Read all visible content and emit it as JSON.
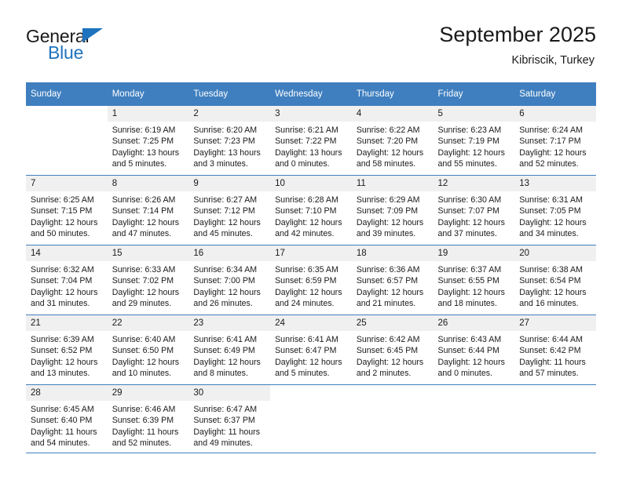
{
  "brand": {
    "name_top": "General",
    "name_bottom": "Blue",
    "triangle_color": "#1e73be"
  },
  "header": {
    "title": "September 2025",
    "subtitle": "Kibriscik, Turkey"
  },
  "theme": {
    "header_blue": "#3f7fbf",
    "daynum_bg": "#f0f0f0",
    "text": "#1a1a1a"
  },
  "weekdays": [
    "Sunday",
    "Monday",
    "Tuesday",
    "Wednesday",
    "Thursday",
    "Friday",
    "Saturday"
  ],
  "labels": {
    "sunrise": "Sunrise:",
    "sunset": "Sunset:",
    "daylight": "Daylight:"
  },
  "weeks": [
    [
      {
        "day": ""
      },
      {
        "day": "1",
        "sunrise": "Sunrise: 6:19 AM",
        "sunset": "Sunset: 7:25 PM",
        "daylight1": "Daylight: 13 hours",
        "daylight2": "and 5 minutes."
      },
      {
        "day": "2",
        "sunrise": "Sunrise: 6:20 AM",
        "sunset": "Sunset: 7:23 PM",
        "daylight1": "Daylight: 13 hours",
        "daylight2": "and 3 minutes."
      },
      {
        "day": "3",
        "sunrise": "Sunrise: 6:21 AM",
        "sunset": "Sunset: 7:22 PM",
        "daylight1": "Daylight: 13 hours",
        "daylight2": "and 0 minutes."
      },
      {
        "day": "4",
        "sunrise": "Sunrise: 6:22 AM",
        "sunset": "Sunset: 7:20 PM",
        "daylight1": "Daylight: 12 hours",
        "daylight2": "and 58 minutes."
      },
      {
        "day": "5",
        "sunrise": "Sunrise: 6:23 AM",
        "sunset": "Sunset: 7:19 PM",
        "daylight1": "Daylight: 12 hours",
        "daylight2": "and 55 minutes."
      },
      {
        "day": "6",
        "sunrise": "Sunrise: 6:24 AM",
        "sunset": "Sunset: 7:17 PM",
        "daylight1": "Daylight: 12 hours",
        "daylight2": "and 52 minutes."
      }
    ],
    [
      {
        "day": "7",
        "sunrise": "Sunrise: 6:25 AM",
        "sunset": "Sunset: 7:15 PM",
        "daylight1": "Daylight: 12 hours",
        "daylight2": "and 50 minutes."
      },
      {
        "day": "8",
        "sunrise": "Sunrise: 6:26 AM",
        "sunset": "Sunset: 7:14 PM",
        "daylight1": "Daylight: 12 hours",
        "daylight2": "and 47 minutes."
      },
      {
        "day": "9",
        "sunrise": "Sunrise: 6:27 AM",
        "sunset": "Sunset: 7:12 PM",
        "daylight1": "Daylight: 12 hours",
        "daylight2": "and 45 minutes."
      },
      {
        "day": "10",
        "sunrise": "Sunrise: 6:28 AM",
        "sunset": "Sunset: 7:10 PM",
        "daylight1": "Daylight: 12 hours",
        "daylight2": "and 42 minutes."
      },
      {
        "day": "11",
        "sunrise": "Sunrise: 6:29 AM",
        "sunset": "Sunset: 7:09 PM",
        "daylight1": "Daylight: 12 hours",
        "daylight2": "and 39 minutes."
      },
      {
        "day": "12",
        "sunrise": "Sunrise: 6:30 AM",
        "sunset": "Sunset: 7:07 PM",
        "daylight1": "Daylight: 12 hours",
        "daylight2": "and 37 minutes."
      },
      {
        "day": "13",
        "sunrise": "Sunrise: 6:31 AM",
        "sunset": "Sunset: 7:05 PM",
        "daylight1": "Daylight: 12 hours",
        "daylight2": "and 34 minutes."
      }
    ],
    [
      {
        "day": "14",
        "sunrise": "Sunrise: 6:32 AM",
        "sunset": "Sunset: 7:04 PM",
        "daylight1": "Daylight: 12 hours",
        "daylight2": "and 31 minutes."
      },
      {
        "day": "15",
        "sunrise": "Sunrise: 6:33 AM",
        "sunset": "Sunset: 7:02 PM",
        "daylight1": "Daylight: 12 hours",
        "daylight2": "and 29 minutes."
      },
      {
        "day": "16",
        "sunrise": "Sunrise: 6:34 AM",
        "sunset": "Sunset: 7:00 PM",
        "daylight1": "Daylight: 12 hours",
        "daylight2": "and 26 minutes."
      },
      {
        "day": "17",
        "sunrise": "Sunrise: 6:35 AM",
        "sunset": "Sunset: 6:59 PM",
        "daylight1": "Daylight: 12 hours",
        "daylight2": "and 24 minutes."
      },
      {
        "day": "18",
        "sunrise": "Sunrise: 6:36 AM",
        "sunset": "Sunset: 6:57 PM",
        "daylight1": "Daylight: 12 hours",
        "daylight2": "and 21 minutes."
      },
      {
        "day": "19",
        "sunrise": "Sunrise: 6:37 AM",
        "sunset": "Sunset: 6:55 PM",
        "daylight1": "Daylight: 12 hours",
        "daylight2": "and 18 minutes."
      },
      {
        "day": "20",
        "sunrise": "Sunrise: 6:38 AM",
        "sunset": "Sunset: 6:54 PM",
        "daylight1": "Daylight: 12 hours",
        "daylight2": "and 16 minutes."
      }
    ],
    [
      {
        "day": "21",
        "sunrise": "Sunrise: 6:39 AM",
        "sunset": "Sunset: 6:52 PM",
        "daylight1": "Daylight: 12 hours",
        "daylight2": "and 13 minutes."
      },
      {
        "day": "22",
        "sunrise": "Sunrise: 6:40 AM",
        "sunset": "Sunset: 6:50 PM",
        "daylight1": "Daylight: 12 hours",
        "daylight2": "and 10 minutes."
      },
      {
        "day": "23",
        "sunrise": "Sunrise: 6:41 AM",
        "sunset": "Sunset: 6:49 PM",
        "daylight1": "Daylight: 12 hours",
        "daylight2": "and 8 minutes."
      },
      {
        "day": "24",
        "sunrise": "Sunrise: 6:41 AM",
        "sunset": "Sunset: 6:47 PM",
        "daylight1": "Daylight: 12 hours",
        "daylight2": "and 5 minutes."
      },
      {
        "day": "25",
        "sunrise": "Sunrise: 6:42 AM",
        "sunset": "Sunset: 6:45 PM",
        "daylight1": "Daylight: 12 hours",
        "daylight2": "and 2 minutes."
      },
      {
        "day": "26",
        "sunrise": "Sunrise: 6:43 AM",
        "sunset": "Sunset: 6:44 PM",
        "daylight1": "Daylight: 12 hours",
        "daylight2": "and 0 minutes."
      },
      {
        "day": "27",
        "sunrise": "Sunrise: 6:44 AM",
        "sunset": "Sunset: 6:42 PM",
        "daylight1": "Daylight: 11 hours",
        "daylight2": "and 57 minutes."
      }
    ],
    [
      {
        "day": "28",
        "sunrise": "Sunrise: 6:45 AM",
        "sunset": "Sunset: 6:40 PM",
        "daylight1": "Daylight: 11 hours",
        "daylight2": "and 54 minutes."
      },
      {
        "day": "29",
        "sunrise": "Sunrise: 6:46 AM",
        "sunset": "Sunset: 6:39 PM",
        "daylight1": "Daylight: 11 hours",
        "daylight2": "and 52 minutes."
      },
      {
        "day": "30",
        "sunrise": "Sunrise: 6:47 AM",
        "sunset": "Sunset: 6:37 PM",
        "daylight1": "Daylight: 11 hours",
        "daylight2": "and 49 minutes."
      },
      {
        "day": ""
      },
      {
        "day": ""
      },
      {
        "day": ""
      },
      {
        "day": ""
      }
    ]
  ]
}
